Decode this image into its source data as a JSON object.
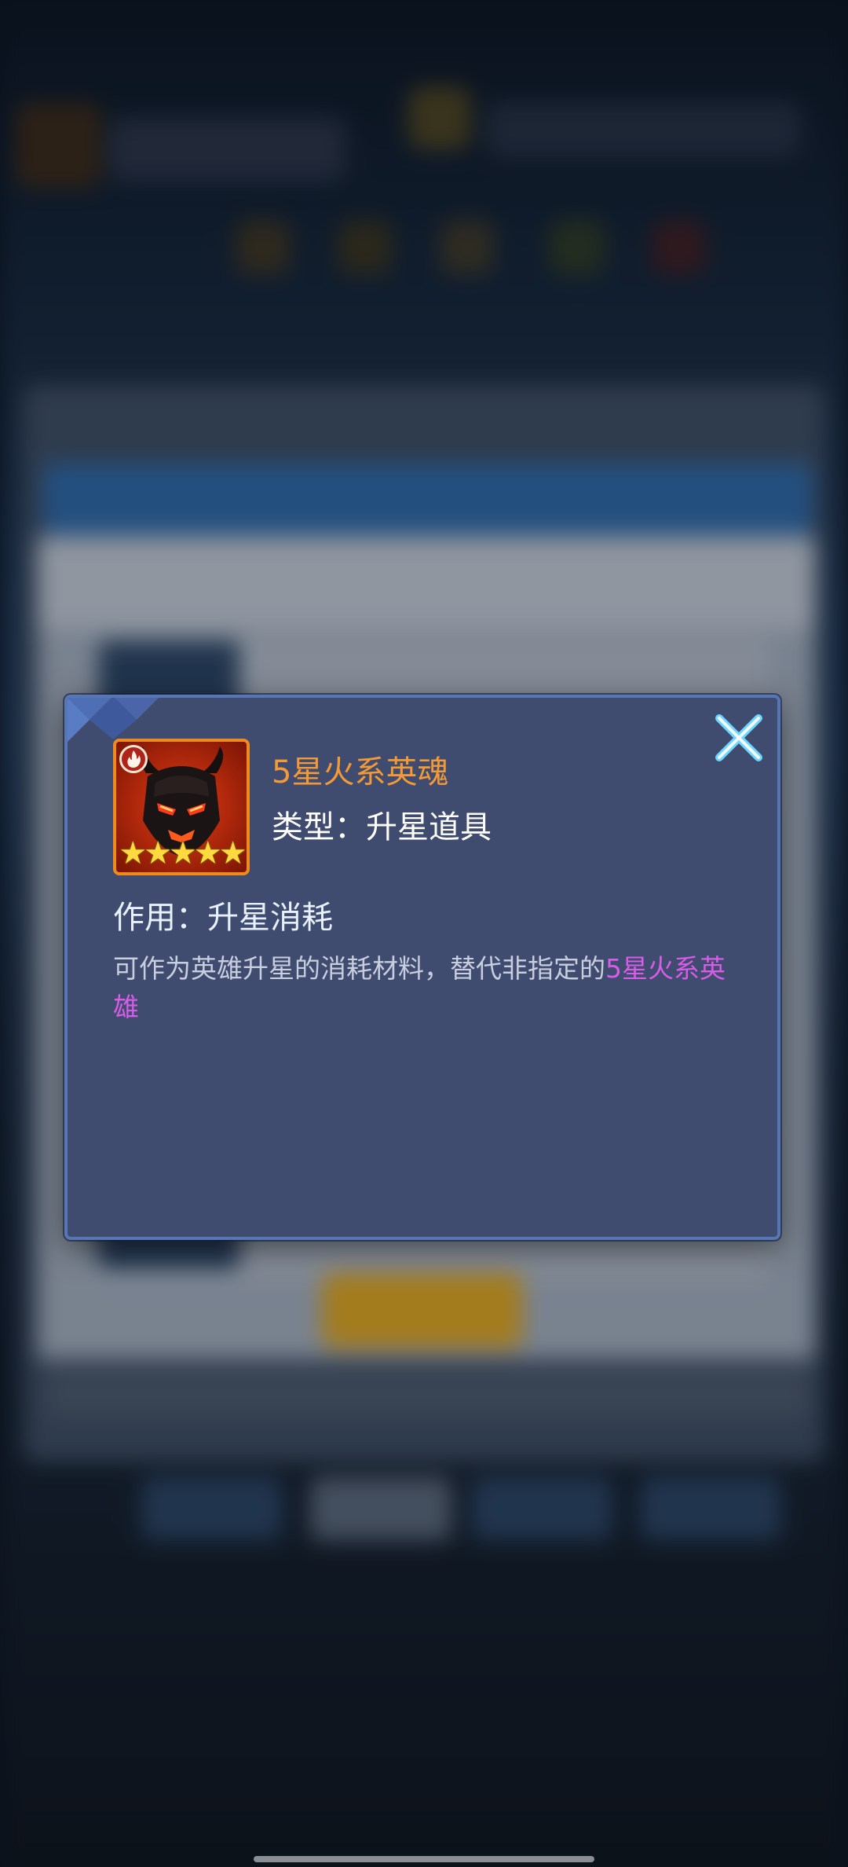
{
  "popup": {
    "item_name": "5星火系英魂",
    "type_label": "类型：",
    "type_value": "升星道具",
    "effect_label": "作用：",
    "effect_value": "升星消耗",
    "description_plain": "可作为英雄升星的消耗材料，替代非指定的",
    "description_highlight": "5星火系英雄",
    "star_count": 5,
    "stars_glyph": "★★★★★"
  },
  "colors": {
    "item_name": "#f39a36",
    "highlight": "#d85ce8",
    "popup_bg": "#404c6f",
    "popup_border": "#5676b4",
    "icon_border": "#f08a1c"
  },
  "icons": {
    "close": "close-icon",
    "element": "fire-element-icon",
    "item": "fire-hero-soul-icon"
  }
}
